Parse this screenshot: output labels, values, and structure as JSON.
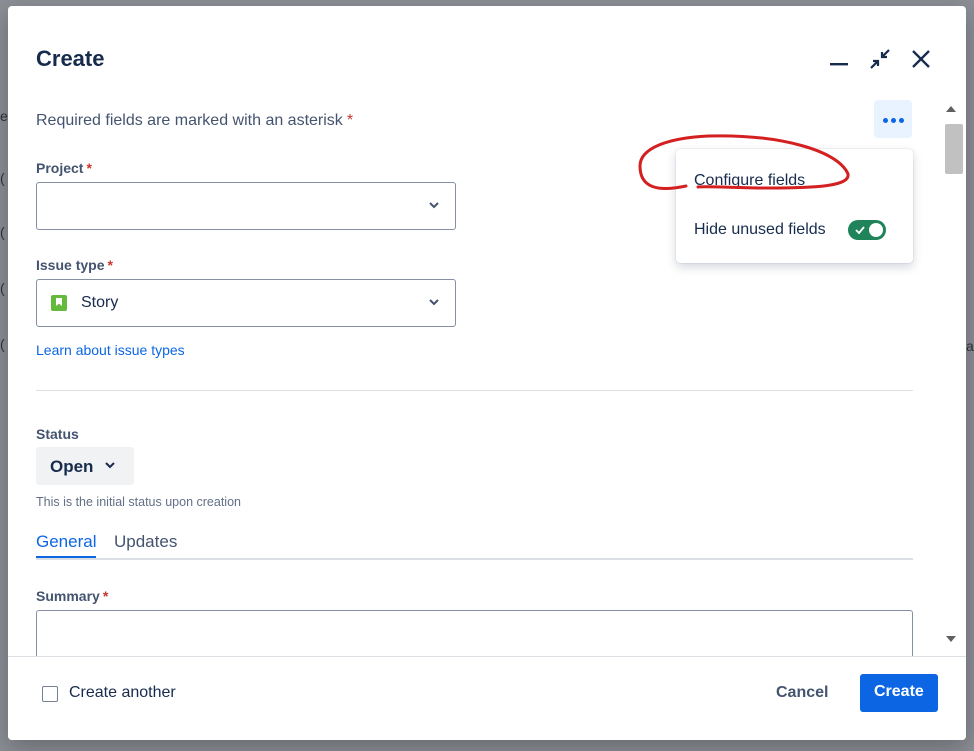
{
  "dialog": {
    "title": "Create",
    "required_note": "Required fields are marked with an asterisk",
    "asterisk": "*"
  },
  "header_icons": [
    "minimize-icon",
    "collapse-icon",
    "close-icon"
  ],
  "more_menu": {
    "button_icon": "more-horizontal-icon",
    "items": [
      {
        "label": "Configure fields"
      },
      {
        "label": "Hide unused fields",
        "toggle_on": true
      }
    ]
  },
  "form": {
    "project": {
      "label": "Project",
      "value": ""
    },
    "issue_type": {
      "label": "Issue type",
      "value": "Story",
      "icon": "story-icon"
    },
    "learn_link": "Learn about issue types",
    "status": {
      "label": "Status",
      "value": "Open",
      "help": "This is the initial status upon creation"
    },
    "tabs": [
      {
        "label": "General",
        "active": true
      },
      {
        "label": "Updates",
        "active": false
      }
    ],
    "summary": {
      "label": "Summary",
      "value": ""
    }
  },
  "footer": {
    "create_another": "Create another",
    "create_another_checked": false,
    "cancel": "Cancel",
    "create": "Create"
  },
  "colors": {
    "accent": "#0c66e4",
    "required": "#c9372c",
    "toggle_on": "#1f845a",
    "annotation": "#d42020"
  }
}
